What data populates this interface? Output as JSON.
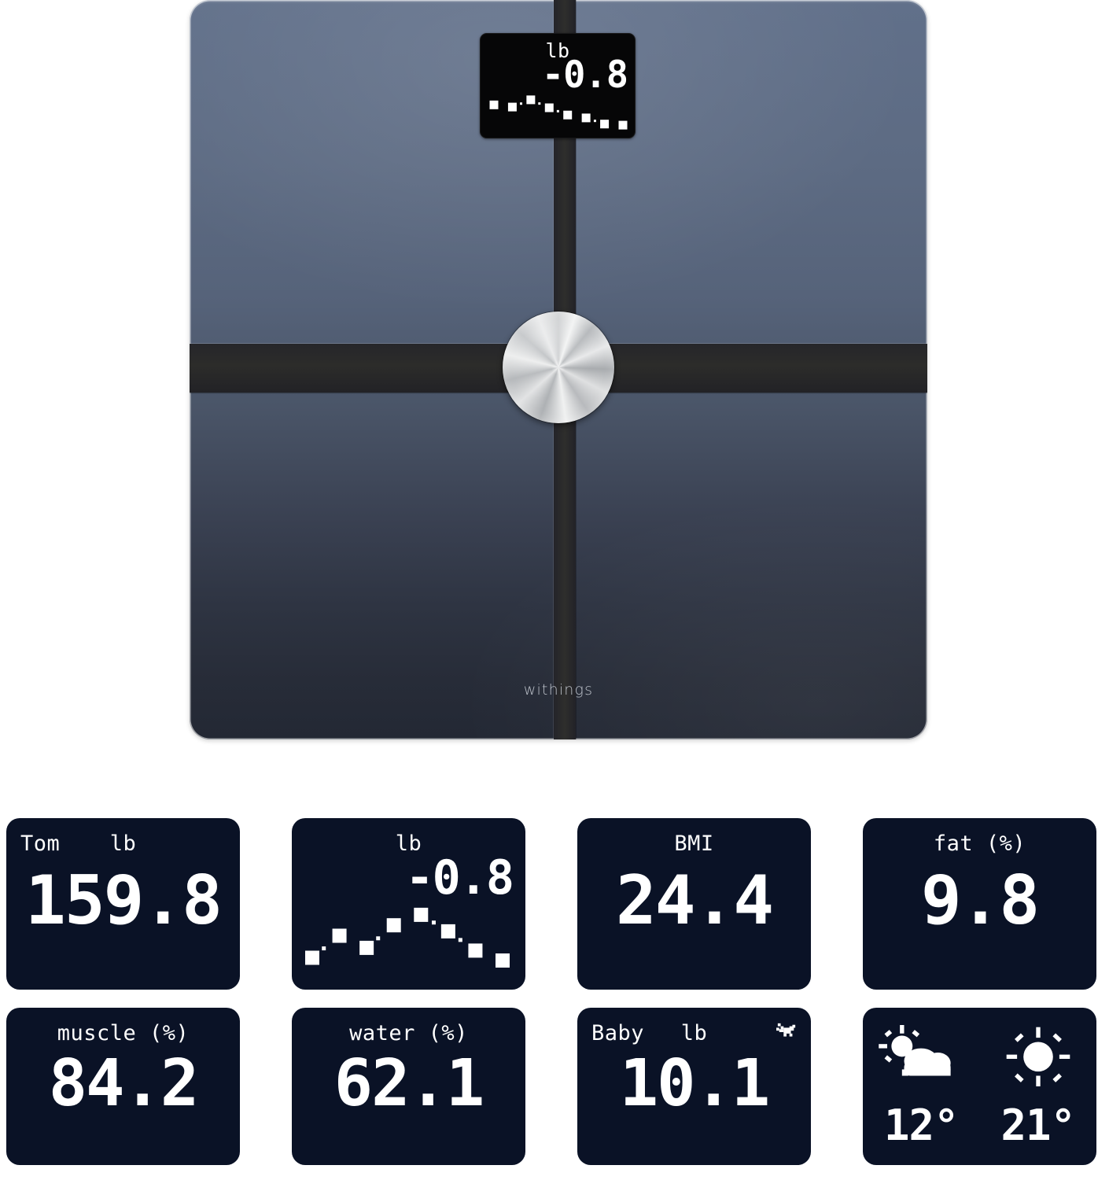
{
  "product": {
    "brand": "withings",
    "colors": {
      "surface_top": "#61708a",
      "surface_bottom": "#232834",
      "band": "#2a2a28",
      "disc": "#c9cbcd",
      "lcd_background": "#060607",
      "panel_background": "#0a1226",
      "panel_text": "#ffffff"
    },
    "display": {
      "unit": "lb",
      "value": "-0.8",
      "chart": {
        "points": [
          0.58,
          0.52,
          0.72,
          0.5,
          0.3,
          0.22,
          0.05,
          0.02
        ]
      }
    }
  },
  "panels": [
    {
      "name": "weight",
      "label_left": "Tom",
      "label_mid": "lb",
      "value": "159.8"
    },
    {
      "name": "trend",
      "label_mid": "lb",
      "value": "-0.8",
      "chart": {
        "points": [
          0.15,
          0.55,
          0.33,
          0.74,
          0.93,
          0.63,
          0.28,
          0.1
        ]
      }
    },
    {
      "name": "bmi",
      "label_mid": "BMI",
      "value": "24.4"
    },
    {
      "name": "fat",
      "label_mid": "fat (%)",
      "value": "9.8"
    },
    {
      "name": "muscle",
      "label_mid": "muscle (%)",
      "value": "84.2"
    },
    {
      "name": "water",
      "label_mid": "water (%)",
      "value": "62.1"
    },
    {
      "name": "baby",
      "label_left": "Baby",
      "label_mid": "lb",
      "value": "10.1",
      "icon": "baby-crawling-icon"
    },
    {
      "name": "weather",
      "today": {
        "icon": "sun-behind-cloud-icon",
        "temp": "12°"
      },
      "tomorrow": {
        "icon": "sun-icon",
        "temp": "21°"
      }
    }
  ],
  "chart_data": [
    {
      "type": "line",
      "title": "Scale display weight trend",
      "ylabel": "lb",
      "x": [
        1,
        2,
        3,
        4,
        5,
        6,
        7,
        8
      ],
      "values": [
        0.58,
        0.52,
        0.72,
        0.5,
        0.3,
        0.22,
        0.05,
        0.02
      ],
      "annotation": "-0.8",
      "grid": false,
      "legend": "none",
      "note": "Normalized marker heights read from pixels; declining trend with dotted connector and square markers."
    },
    {
      "type": "line",
      "title": "Trend panel weight change",
      "ylabel": "lb",
      "x": [
        1,
        2,
        3,
        4,
        5,
        6,
        7,
        8
      ],
      "values": [
        0.15,
        0.55,
        0.33,
        0.74,
        0.93,
        0.63,
        0.28,
        0.1
      ],
      "annotation": "-0.8",
      "grid": false,
      "legend": "none",
      "note": "Normalized marker heights read from pixels; rise to mid peak then decline, dotted connector with square markers."
    }
  ]
}
